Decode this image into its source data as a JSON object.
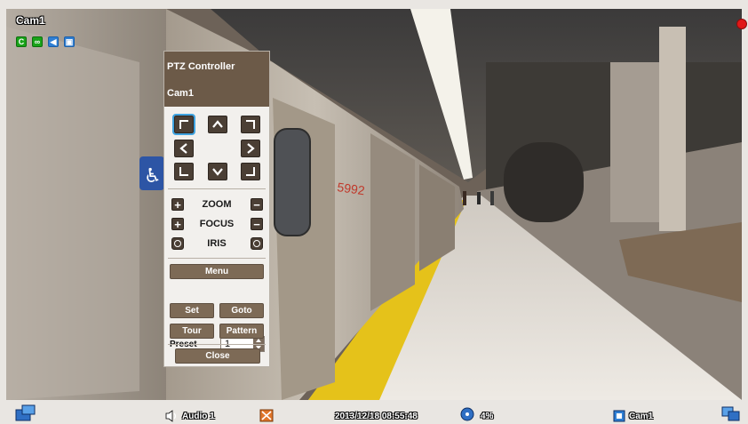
{
  "camera": {
    "title": "Cam1"
  },
  "status_icons": [
    {
      "name": "c-icon",
      "glyph": "C",
      "color": "#19a319"
    },
    {
      "name": "motion-icon",
      "glyph": "∞",
      "color": "#19a319"
    },
    {
      "name": "speaker-icon",
      "glyph": "◀",
      "color": "#2f7fd4"
    },
    {
      "name": "camera-status-icon",
      "glyph": "▣",
      "color": "#2f7fd4"
    }
  ],
  "recording": {
    "color": "#e11818"
  },
  "ptz": {
    "title": "PTZ Controller",
    "camera": "Cam1",
    "zoom_label": "ZOOM",
    "focus_label": "FOCUS",
    "iris_label": "IRIS",
    "menu_label": "Menu",
    "preset_label": "Preset",
    "preset_value": "1",
    "set_label": "Set",
    "goto_label": "Goto",
    "tour_label": "Tour",
    "pattern_label": "Pattern",
    "close_label": "Close",
    "minus": "−",
    "plus": "+"
  },
  "status_bar": {
    "audio_label": "Audio 1",
    "datetime": "2013/12/18 08:55:48",
    "disk_usage": "4%",
    "camera_label": "Cam1"
  },
  "scene": {
    "car_number": "5992"
  }
}
